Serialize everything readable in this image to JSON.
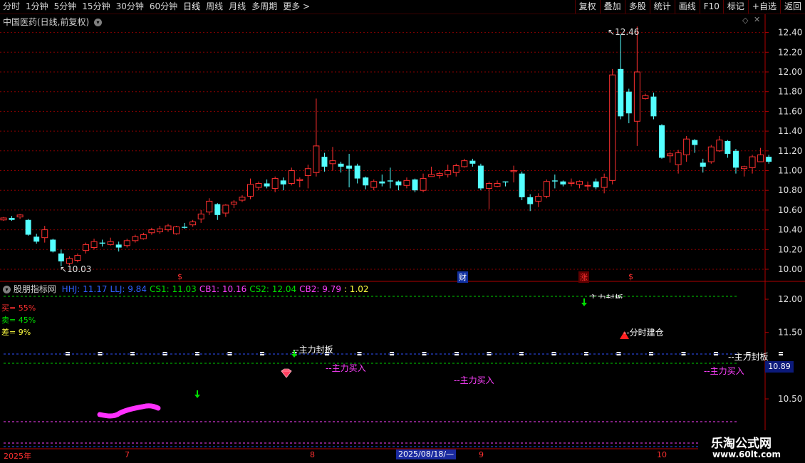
{
  "toolbar": {
    "periods": [
      "分时",
      "1分钟",
      "5分钟",
      "15分钟",
      "30分钟",
      "60分钟",
      "日线",
      "周线",
      "月线",
      "多周期",
      "更多 >"
    ],
    "active_period": "日线",
    "buttons": [
      "复权",
      "叠加",
      "多股",
      "统计",
      "画线",
      "F10",
      "标记",
      "+自选",
      "返回"
    ]
  },
  "main_chart": {
    "title": "中国医药(日线,前复权)",
    "price_axis": [
      "12.40",
      "12.20",
      "12.00",
      "11.80",
      "11.60",
      "11.40",
      "11.20",
      "11.00",
      "10.80",
      "10.60",
      "10.40",
      "10.20",
      "10.00"
    ],
    "high_label": "12.46",
    "low_label": "10.03",
    "event_markers": [
      {
        "label": "$",
        "color": "#ff3030"
      },
      {
        "label": "财",
        "color": "#ffffff"
      },
      {
        "label": "涨",
        "color": "#ff3030"
      },
      {
        "label": "$",
        "color": "#ff3030"
      }
    ]
  },
  "indicator": {
    "name": "股朋指标网",
    "values": [
      {
        "label": "HHJ",
        "value": "11.17",
        "color": "#3060ff"
      },
      {
        "label": "LLJ",
        "value": "9.84",
        "color": "#3060ff"
      },
      {
        "label": "CS1",
        "value": "11.03",
        "color": "#00e000"
      },
      {
        "label": "CB1",
        "value": "10.16",
        "color": "#ff40ff"
      },
      {
        "label": "CS2",
        "value": "12.04",
        "color": "#00e000"
      },
      {
        "label": "CB2",
        "value": "9.79",
        "color": "#ff40ff"
      },
      {
        "label": "",
        "value": "1.02",
        "color": "#ffff40"
      }
    ],
    "buy_text": "买= 55%",
    "sell_text": "卖= 45%",
    "diff_text": "差= 9%",
    "axis": [
      "12.00",
      "11.50",
      "10.50"
    ],
    "current_value": "10.89",
    "signals": {
      "main_seal_1": "--主力封板",
      "main_seal_2": "--主力封板",
      "main_seal_3": "--主力封板",
      "main_buy_1": "--主力买入",
      "main_buy_2": "--主力买入",
      "main_buy_3": "--主力买入",
      "build_position": "--分时建仓"
    }
  },
  "date_axis": {
    "year": "2025年",
    "months": [
      "7",
      "8",
      "9",
      "10"
    ],
    "cursor_date": "2025/08/18/—"
  },
  "watermark": {
    "title": "乐淘公式网",
    "url": "www.60lt.com"
  },
  "colors": {
    "up": "#ff3030",
    "down": "#54ffff",
    "grid": "#8b0000",
    "axis_text": "#e0e0e0"
  },
  "chart_data": {
    "type": "candlestick",
    "candles": [
      [
        10.5,
        10.52,
        10.53,
        10.49
      ],
      [
        10.52,
        10.5,
        10.54,
        10.49
      ],
      [
        10.53,
        10.55,
        10.56,
        10.51
      ],
      [
        10.5,
        10.35,
        10.51,
        10.34
      ],
      [
        10.33,
        10.28,
        10.36,
        10.26
      ],
      [
        10.32,
        10.4,
        10.44,
        10.27
      ],
      [
        10.3,
        10.18,
        10.31,
        10.17
      ],
      [
        10.16,
        10.08,
        10.2,
        10.03
      ],
      [
        10.06,
        10.11,
        10.13,
        10.04
      ],
      [
        10.09,
        10.14,
        10.16,
        10.07
      ],
      [
        10.19,
        10.25,
        10.27,
        10.16
      ],
      [
        10.22,
        10.28,
        10.31,
        10.2
      ],
      [
        10.27,
        10.26,
        10.3,
        10.23
      ],
      [
        10.25,
        10.28,
        10.32,
        10.24
      ],
      [
        10.25,
        10.22,
        10.28,
        10.18
      ],
      [
        10.24,
        10.29,
        10.31,
        10.22
      ],
      [
        10.29,
        10.33,
        10.35,
        10.27
      ],
      [
        10.31,
        10.35,
        10.37,
        10.3
      ],
      [
        10.37,
        10.4,
        10.42,
        10.35
      ],
      [
        10.38,
        10.41,
        10.44,
        10.36
      ],
      [
        10.4,
        10.44,
        10.46,
        10.38
      ],
      [
        10.36,
        10.43,
        10.44,
        10.35
      ],
      [
        10.43,
        10.42,
        10.47,
        10.41
      ],
      [
        10.45,
        10.48,
        10.5,
        10.43
      ],
      [
        10.51,
        10.56,
        10.6,
        10.47
      ],
      [
        10.58,
        10.69,
        10.72,
        10.55
      ],
      [
        10.66,
        10.55,
        10.67,
        10.5
      ],
      [
        10.57,
        10.65,
        10.66,
        10.53
      ],
      [
        10.66,
        10.68,
        10.7,
        10.62
      ],
      [
        10.7,
        10.73,
        10.75,
        10.68
      ],
      [
        10.74,
        10.86,
        10.92,
        10.71
      ],
      [
        10.83,
        10.87,
        10.89,
        10.8
      ],
      [
        10.87,
        10.84,
        10.91,
        10.82
      ],
      [
        10.82,
        10.92,
        10.94,
        10.78
      ],
      [
        10.9,
        10.86,
        10.93,
        10.8
      ],
      [
        10.87,
        11.0,
        11.03,
        10.85
      ],
      [
        10.9,
        10.91,
        10.93,
        10.83
      ],
      [
        10.95,
        11.02,
        11.06,
        10.82
      ],
      [
        10.98,
        11.25,
        11.73,
        10.94
      ],
      [
        11.14,
        11.04,
        11.18,
        10.99
      ],
      [
        11.07,
        11.1,
        11.24,
        11.0
      ],
      [
        11.07,
        11.04,
        11.09,
        10.98
      ],
      [
        11.05,
        11.02,
        11.17,
        10.83
      ],
      [
        11.05,
        10.92,
        11.07,
        10.87
      ],
      [
        10.93,
        10.85,
        10.94,
        10.81
      ],
      [
        10.83,
        10.89,
        10.91,
        10.8
      ],
      [
        10.89,
        10.87,
        10.96,
        10.84
      ],
      [
        10.9,
        10.89,
        11.03,
        10.82
      ],
      [
        10.89,
        10.85,
        10.9,
        10.8
      ],
      [
        10.85,
        10.9,
        10.93,
        10.82
      ],
      [
        10.91,
        10.8,
        10.92,
        10.78
      ],
      [
        10.8,
        10.92,
        10.97,
        10.78
      ],
      [
        10.94,
        10.96,
        11.04,
        10.94
      ],
      [
        10.95,
        10.97,
        10.99,
        10.92
      ],
      [
        10.96,
        11.0,
        11.06,
        10.93
      ],
      [
        10.98,
        11.05,
        11.07,
        10.94
      ],
      [
        11.04,
        11.1,
        11.12,
        11.03
      ],
      [
        11.1,
        11.07,
        11.12,
        11.04
      ],
      [
        11.05,
        10.82,
        11.07,
        10.8
      ],
      [
        10.82,
        10.87,
        10.89,
        10.61
      ],
      [
        10.84,
        10.87,
        10.9,
        10.83
      ],
      [
        10.89,
        10.88,
        10.89,
        10.84
      ],
      [
        10.99,
        11.0,
        11.05,
        10.88
      ],
      [
        10.97,
        10.73,
        10.99,
        10.7
      ],
      [
        10.73,
        10.66,
        10.76,
        10.59
      ],
      [
        10.69,
        10.74,
        10.77,
        10.63
      ],
      [
        10.74,
        10.89,
        10.91,
        10.72
      ],
      [
        10.9,
        10.89,
        10.96,
        10.82
      ],
      [
        10.89,
        10.86,
        10.9,
        10.84
      ],
      [
        10.87,
        10.88,
        10.92,
        10.84
      ],
      [
        10.86,
        10.89,
        10.9,
        10.82
      ],
      [
        10.85,
        10.85,
        10.89,
        10.8
      ],
      [
        10.89,
        10.83,
        10.92,
        10.81
      ],
      [
        10.83,
        10.93,
        10.97,
        10.77
      ],
      [
        10.9,
        11.97,
        12.03,
        10.86
      ],
      [
        12.03,
        11.55,
        12.38,
        11.52
      ],
      [
        11.8,
        11.58,
        11.83,
        11.48
      ],
      [
        11.5,
        12.0,
        12.46,
        11.25
      ],
      [
        11.73,
        11.76,
        11.78,
        11.72
      ],
      [
        11.75,
        11.55,
        11.79,
        11.52
      ],
      [
        11.46,
        11.13,
        11.47,
        11.12
      ],
      [
        11.15,
        11.17,
        11.19,
        11.08
      ],
      [
        11.06,
        11.18,
        11.21,
        10.97
      ],
      [
        11.16,
        11.32,
        11.35,
        11.09
      ],
      [
        11.31,
        11.26,
        11.32,
        11.18
      ],
      [
        11.08,
        11.04,
        11.12,
        10.98
      ],
      [
        11.09,
        11.24,
        11.26,
        11.07
      ],
      [
        11.2,
        11.31,
        11.35,
        11.19
      ],
      [
        11.3,
        11.17,
        11.31,
        11.13
      ],
      [
        11.2,
        11.03,
        11.22,
        10.97
      ],
      [
        11.02,
        11.04,
        11.05,
        10.94
      ],
      [
        11.03,
        11.14,
        11.16,
        10.97
      ],
      [
        11.09,
        11.16,
        11.23,
        11.11
      ],
      [
        11.14,
        11.09,
        11.16,
        11.07
      ]
    ]
  }
}
